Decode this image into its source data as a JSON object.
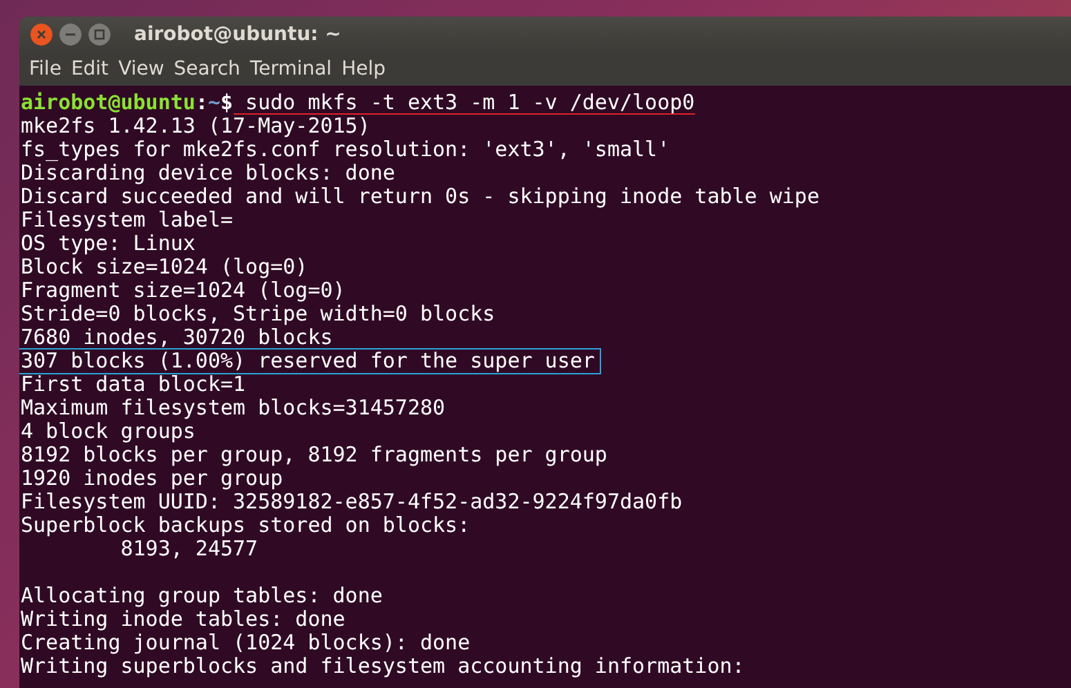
{
  "window": {
    "title": "airobot@ubuntu: ~"
  },
  "menu": [
    {
      "label": "File"
    },
    {
      "label": "Edit"
    },
    {
      "label": "View"
    },
    {
      "label": "Search"
    },
    {
      "label": "Terminal"
    },
    {
      "label": "Help"
    }
  ],
  "terminal": {
    "prompt": {
      "user_host": "airobot@ubuntu",
      "separator": ":",
      "path": "~",
      "symbol": "$",
      "command": "sudo mkfs -t ext3 -m 1 -v /dev/loop0",
      "underlined": true
    },
    "paragraphs": [
      {
        "lines": [
          {
            "text": "mke2fs 1.42.13 (17-May-2015)",
            "highlighted": false
          },
          {
            "text": "fs_types for mke2fs.conf resolution: 'ext3', 'small'",
            "highlighted": false
          },
          {
            "text": "Discarding device blocks: done",
            "highlighted": false
          },
          {
            "text": "Discard succeeded and will return 0s - skipping inode table wipe",
            "highlighted": false
          },
          {
            "text": "Filesystem label=",
            "highlighted": false
          },
          {
            "text": "OS type: Linux",
            "highlighted": false
          },
          {
            "text": "Block size=1024 (log=0)",
            "highlighted": false
          },
          {
            "text": "Fragment size=1024 (log=0)",
            "highlighted": false
          },
          {
            "text": "Stride=0 blocks, Stripe width=0 blocks",
            "highlighted": false
          },
          {
            "text": "7680 inodes, 30720 blocks",
            "highlighted": false
          },
          {
            "text": "307 blocks (1.00%) reserved for the super user",
            "highlighted": true
          },
          {
            "text": "First data block=1",
            "highlighted": false
          },
          {
            "text": "Maximum filesystem blocks=31457280",
            "highlighted": false
          },
          {
            "text": "4 block groups",
            "highlighted": false
          },
          {
            "text": "8192 blocks per group, 8192 fragments per group",
            "highlighted": false
          },
          {
            "text": "1920 inodes per group",
            "highlighted": false
          },
          {
            "text": "Filesystem UUID: 32589182-e857-4f52-ad32-9224f97da0fb",
            "highlighted": false
          },
          {
            "text": "Superblock backups stored on blocks:",
            "highlighted": false
          },
          {
            "text": "        8193, 24577",
            "highlighted": false
          }
        ]
      },
      {
        "lines": [
          {
            "text": "Allocating group tables: done",
            "highlighted": false
          },
          {
            "text": "Writing inode tables: done",
            "highlighted": false
          },
          {
            "text": "Creating journal (1024 blocks): done",
            "highlighted": false
          },
          {
            "text": "Writing superblocks and filesystem accounting information:",
            "highlighted": false
          }
        ]
      }
    ]
  }
}
